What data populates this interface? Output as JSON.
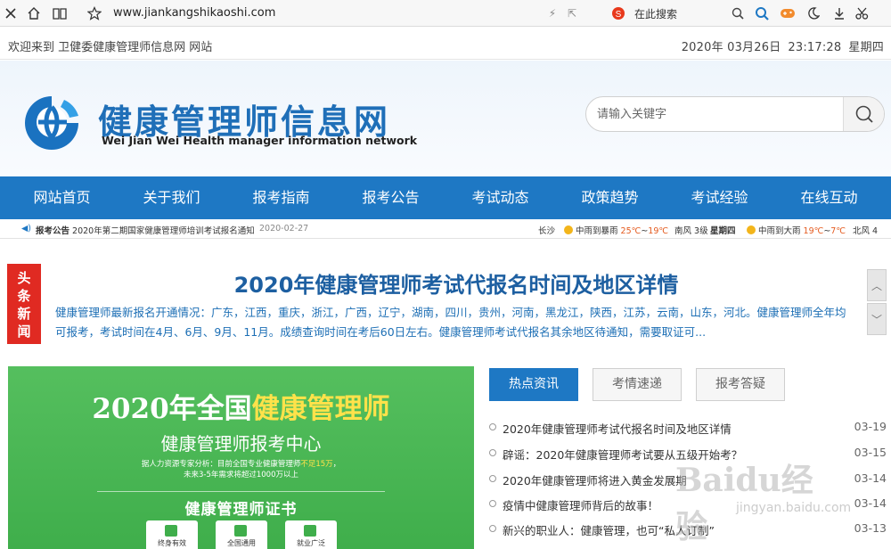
{
  "browser": {
    "url": "www.jiankangshikaoshi.com",
    "search_placeholder": "在此搜索",
    "icons": [
      "close-icon",
      "home-icon",
      "reader-icon",
      "star-icon",
      "lightning-icon",
      "share-icon",
      "sogou-icon",
      "search-icon",
      "game-icon",
      "moon-icon",
      "download-icon",
      "cut-icon"
    ]
  },
  "topbar": {
    "welcome": "欢迎来到 卫健委健康管理师信息网 网站",
    "date": "2020年 03月26日",
    "time": "23:17:28",
    "weekday": "星期四"
  },
  "header": {
    "site_title": "健康管理师信息网",
    "site_subtitle": "Wei Jian Wei Health manager information network",
    "search_placeholder": "请输入关键字"
  },
  "nav": {
    "items": [
      "网站首页",
      "关于我们",
      "报考指南",
      "报考公告",
      "考试动态",
      "政策趋势",
      "考试经验",
      "在线互动"
    ]
  },
  "ticker": {
    "notice_label": "报考公告",
    "notice_text": "2020年第二期国家健康管理师培训考试报名通知",
    "notice_date": "2020-02-27",
    "city": "长沙",
    "weather1": "中雨到暴雨",
    "temp1_hi": "25℃",
    "temp1_sep": "~",
    "temp1_lo": "19℃",
    "wind1": "南风 3级",
    "day1": "星期四",
    "weather2": "中雨到大雨",
    "temp2_hi": "19℃",
    "temp2_sep": "~",
    "temp2_lo": "7℃",
    "wind2": "北风 4"
  },
  "headline": {
    "badge": "头条新闻",
    "title": "2020年健康管理师考试代报名时间及地区详情",
    "summary": "健康管理师最新报名开通情况：广东，江西，重庆，浙江，广西，辽宁，湖南，四川，贵州，河南，黑龙江，陕西，江苏，云南，山东，河北。健康管理师全年均可报考，考试时间在4月、6月、9月、11月。成绩查询时间在考后60日左右。健康管理师考试代报名其余地区待通知，需要取证可..."
  },
  "banner": {
    "line1_prefix": "2020年全国",
    "line1_highlight": "健康管理师",
    "line2": "健康管理师报考中心",
    "note_prefix": "据人力资源专家分析：目前全国专业健康管理师",
    "note_highlight": "不足15万",
    "note_suffix": "，",
    "note_line2": "未来3-5年需求将超过1000万以上",
    "line3": "健康管理师证书",
    "cards": [
      "终身有效",
      "全国通用",
      "就业广泛"
    ]
  },
  "tabs": [
    "热点资讯",
    "考情速递",
    "报考答疑"
  ],
  "news": [
    {
      "title": "2020年健康管理师考试代报名时间及地区详情",
      "date": "03-19"
    },
    {
      "title": "辟谣：2020年健康管理师考试要从五级开始考？",
      "date": "03-15"
    },
    {
      "title": "2020年健康管理师将进入黄金发展期",
      "date": "03-14"
    },
    {
      "title": "疫情中健康管理师背后的故事！",
      "date": "03-14"
    },
    {
      "title": "新兴的职业人：健康管理，也可“私人订制”",
      "date": "03-13"
    }
  ],
  "watermark": {
    "text": "Baidu经验",
    "url": "jingyan.baidu.com"
  },
  "colors": {
    "brand_blue": "#1e78c4",
    "headline_red": "#e02a22",
    "banner_green": "#46b352"
  }
}
